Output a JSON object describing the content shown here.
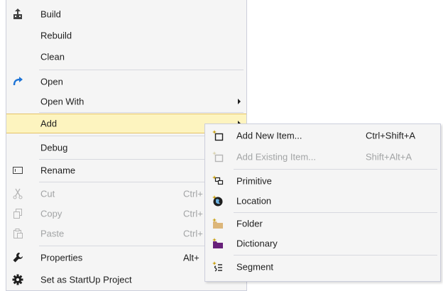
{
  "menu": {
    "items": [
      {
        "label": "Build",
        "icon": "build-icon"
      },
      {
        "label": "Rebuild"
      },
      {
        "label": "Clean"
      },
      {
        "label": "Open",
        "icon": "open-arrow-icon"
      },
      {
        "label": "Open With"
      },
      {
        "label": "Add"
      },
      {
        "label": "Debug"
      },
      {
        "label": "Rename",
        "icon": "rename-icon"
      },
      {
        "label": "Cut",
        "shortcut": "Ctrl+",
        "icon": "cut-icon"
      },
      {
        "label": "Copy",
        "shortcut": "Ctrl+",
        "icon": "copy-icon"
      },
      {
        "label": "Paste",
        "shortcut": "Ctrl+",
        "icon": "paste-icon"
      },
      {
        "label": "Properties",
        "shortcut": "Alt+",
        "icon": "wrench-icon"
      },
      {
        "label": "Set as StartUp Project",
        "icon": "gear-icon"
      }
    ]
  },
  "submenu": {
    "items": [
      {
        "label": "Add New Item...",
        "shortcut": "Ctrl+Shift+A",
        "icon": "add-new-item-icon"
      },
      {
        "label": "Add Existing Item...",
        "shortcut": "Shift+Alt+A",
        "icon": "add-existing-item-icon"
      },
      {
        "label": "Primitive",
        "icon": "primitive-icon"
      },
      {
        "label": "Location",
        "icon": "location-icon"
      },
      {
        "label": "Folder",
        "icon": "folder-icon"
      },
      {
        "label": "Dictionary",
        "icon": "dictionary-icon"
      },
      {
        "label": "Segment",
        "icon": "segment-icon"
      }
    ]
  },
  "colors": {
    "highlight": "#fdf4bf",
    "highlight_border": "#e5c365",
    "menu_bg": "#f5f5f5",
    "disabled_text": "#a2a4a5",
    "accent_blue": "#1e74d6",
    "folder_yellow": "#dcb67a",
    "dictionary_purple": "#68217a"
  }
}
